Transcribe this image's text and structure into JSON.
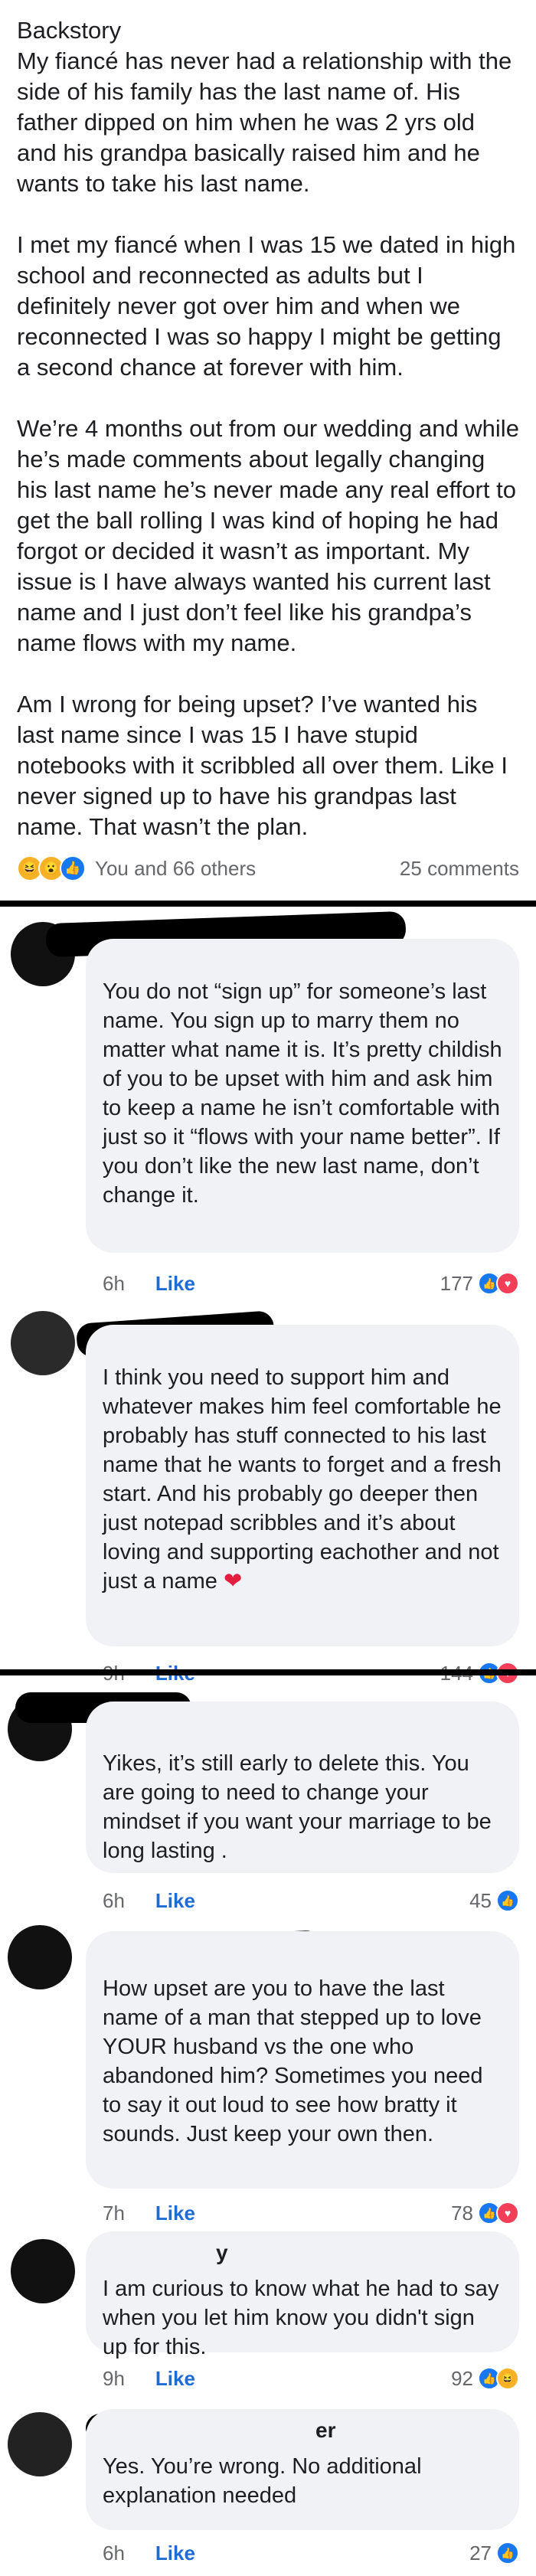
{
  "post": {
    "paragraphs": [
      "Backstory\nMy fiancé has never had a relationship with the side of his family has the last name of. His father dipped on him when he was 2 yrs old and his grandpa basically raised him and he wants to take his last name.",
      "I met my fiancé when I was 15 we dated in high school and reconnected as adults but I definitely never got over him and when we reconnected I was so happy I might be getting a second chance at forever with him.",
      "We’re 4 months out from our wedding and while he’s made comments about legally changing his last name he’s never made any real effort to get the ball rolling I was kind of hoping he had forgot or decided it wasn’t as important. My issue is I have always wanted his current last name and I just don’t feel like his grandpa’s name flows with my name.",
      "Am I wrong for being upset? I’ve wanted his last name since I was 15 I have stupid notebooks with it scribbled all over them. Like I never signed up to have his grandpas last name. That wasn’t the plan."
    ],
    "reactions_text": "You and 66 others",
    "comments_count": "25 comments",
    "reaction_icons": [
      "laugh-icon",
      "wow-icon",
      "like-icon"
    ]
  },
  "comments": [
    {
      "text": "You do not “sign up” for someone’s last name. You sign up to marry them no matter what name it is. It’s pretty childish of you to be upset with him and ask him to keep a name he isn’t comfortable with just so it “flows with your name better”. If you don’t like the new last name, don’t change it.",
      "time": "6h",
      "like": "Like",
      "count": "177",
      "reacts": [
        "like",
        "love"
      ]
    },
    {
      "text": "I think you need to support him and whatever makes him feel comfortable he probably has stuff connected to his last name that he wants to forget and a fresh start. And his probably go deeper then just notepad scribbles and it’s about loving and supporting eachother and not just a name",
      "emoji": "❤",
      "time": "9h",
      "like": "Like",
      "count": "144",
      "reacts": [
        "like",
        "love"
      ]
    },
    {
      "text": "Yikes, it’s still early to delete this. You are going to need to change your mindset if you want your marriage to be long lasting .",
      "time": "6h",
      "like": "Like",
      "count": "45",
      "reacts": [
        "like"
      ]
    },
    {
      "text": "How upset are you to have the last name of a man that stepped up to love YOUR husband vs the one who abandoned him? Sometimes you need to say it out loud to see how bratty it sounds. Just keep your own then.",
      "time": "7h",
      "like": "Like",
      "count": "78",
      "reacts": [
        "like",
        "love"
      ]
    },
    {
      "name_fragment": "y",
      "text": "I am curious to know what he had to say when you let him know you didn't sign up for this.",
      "time": "9h",
      "like": "Like",
      "count": "92",
      "reacts": [
        "like",
        "haha"
      ]
    },
    {
      "name_fragment": "er",
      "text": "Yes. You’re wrong. No additional explanation needed",
      "time": "6h",
      "like": "Like",
      "count": "27",
      "reacts": [
        "like"
      ]
    }
  ]
}
